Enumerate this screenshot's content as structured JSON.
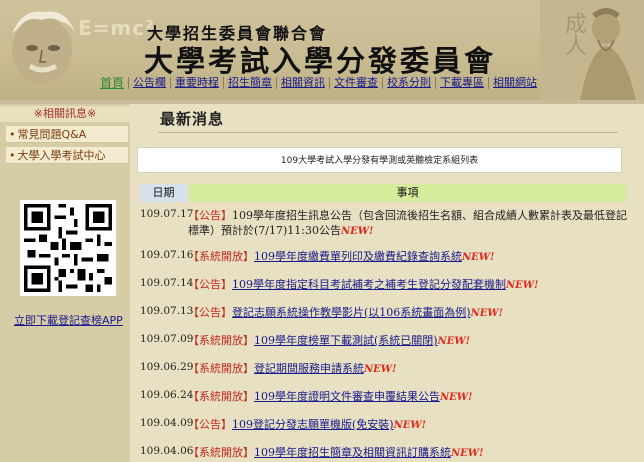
{
  "header": {
    "sub_title": "大學招生委員會聯合會",
    "main_title": "大學考試入學分發委員會",
    "nav": [
      {
        "label": "首頁",
        "name": "nav-home",
        "active": true
      },
      {
        "label": "公告欄",
        "name": "nav-announcements"
      },
      {
        "label": "重要時程",
        "name": "nav-schedule"
      },
      {
        "label": "招生簡章",
        "name": "nav-prospectus"
      },
      {
        "label": "相關資訊",
        "name": "nav-related-info"
      },
      {
        "label": "文件審查",
        "name": "nav-document-review"
      },
      {
        "label": "校系分則",
        "name": "nav-department-rules"
      },
      {
        "label": "下載專區",
        "name": "nav-downloads"
      },
      {
        "label": "相關網站",
        "name": "nav-related-sites"
      }
    ]
  },
  "sidebar": {
    "title": "※相關訊息※",
    "items": [
      {
        "label": "常見問題Q&A"
      },
      {
        "label": "大學入學考試中心"
      }
    ],
    "app_link": "立即下載登記查榜APP"
  },
  "main": {
    "page_title": "最新消息",
    "notice": "109大學考試入學分發有學測或英聽檢定系組列表",
    "table_headers": {
      "date": "日期",
      "item": "事項"
    },
    "new_label": "NEW!",
    "rows": [
      {
        "date": "109.07.17",
        "tag": "【公告】",
        "text": "109學年度招生訊息公告（包含回流後招生名額、組合成績人數累計表及最低登記標準）預計於(7/17)11:30公告",
        "link": false,
        "tall": true
      },
      {
        "date": "109.07.16",
        "tag": "【系統開放】",
        "text": "109學年度繳費單列印及繳費紀錄查詢系統",
        "link": true
      },
      {
        "date": "109.07.14",
        "tag": "【公告】",
        "text": "109學年度指定科目考試補考之補考生登記分發配套機制",
        "link": true
      },
      {
        "date": "109.07.13",
        "tag": "【公告】",
        "text": "登記志願系統操作教學影片(以106系統畫面為例)",
        "link": true
      },
      {
        "date": "109.07.09",
        "tag": "【系統開放】",
        "text": "109學年度榜單下載測試(系統已關閉)",
        "link": true
      },
      {
        "date": "109.06.29",
        "tag": "【系統開放】",
        "text": "登記期間服務申請系統",
        "link": true
      },
      {
        "date": "109.06.24",
        "tag": "【系統開放】",
        "text": "109學年度證明文件審查申覆結果公告",
        "link": true
      },
      {
        "date": "109.04.09",
        "tag": "【公告】",
        "text": "109登記分發志願單機版(免安裝)",
        "link": true
      },
      {
        "date": "109.04.06",
        "tag": "【系統開放】",
        "text": "109學年度招生簡章及相關資訊訂購系統",
        "link": true
      }
    ]
  }
}
